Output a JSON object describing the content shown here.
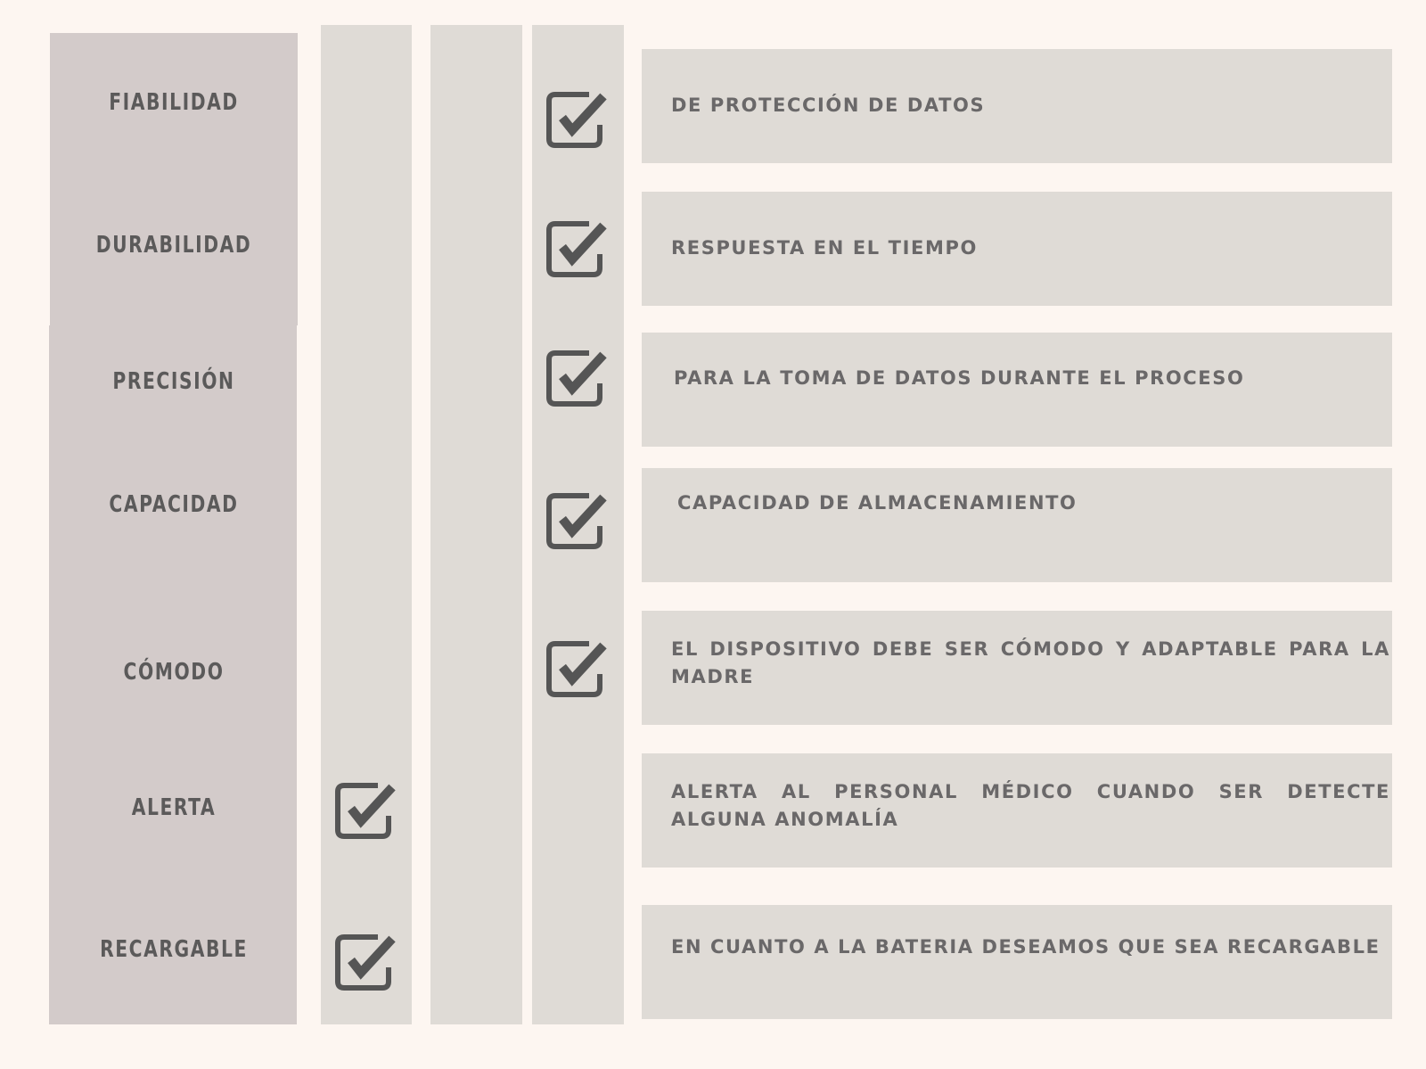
{
  "rows": [
    {
      "label": "FIABILIDAD",
      "description": "DE PROTECCIÓN DE DATOS",
      "col1_checked": false,
      "col3_checked": true
    },
    {
      "label": "DURABILIDAD",
      "description": "RESPUESTA EN EL TIEMPO",
      "col1_checked": false,
      "col3_checked": true
    },
    {
      "label": "PRECISIÓN",
      "description": "PARA LA TOMA DE DATOS DURANTE EL PROCESO",
      "col1_checked": false,
      "col3_checked": true
    },
    {
      "label": "CAPACIDAD",
      "description": "CAPACIDAD DE ALMACENAMIENTO",
      "col1_checked": false,
      "col3_checked": true
    },
    {
      "label": "CÓMODO",
      "description": "EL DISPOSITIVO DEBE SER CÓMODO Y ADAPTABLE PARA LA MADRE",
      "col1_checked": false,
      "col3_checked": true
    },
    {
      "label": "ALERTA",
      "description": "ALERTA AL PERSONAL MÉDICO CUANDO SER DETECTE ALGUNA ANOMALÍA",
      "col1_checked": true,
      "col3_checked": false
    },
    {
      "label": "RECARGABLE",
      "description": "EN CUANTO A LA BATERIA DESEAMOS QUE SEA RECARGABLE",
      "col1_checked": true,
      "col3_checked": false
    }
  ],
  "icons": {
    "checkbox": "checked-checkbox-icon"
  },
  "colors": {
    "background": "#fdf6f1",
    "label_column": "#d3cbca",
    "columns": "#dfdbd6",
    "text": "#5b5a5a",
    "check": "#555555"
  }
}
